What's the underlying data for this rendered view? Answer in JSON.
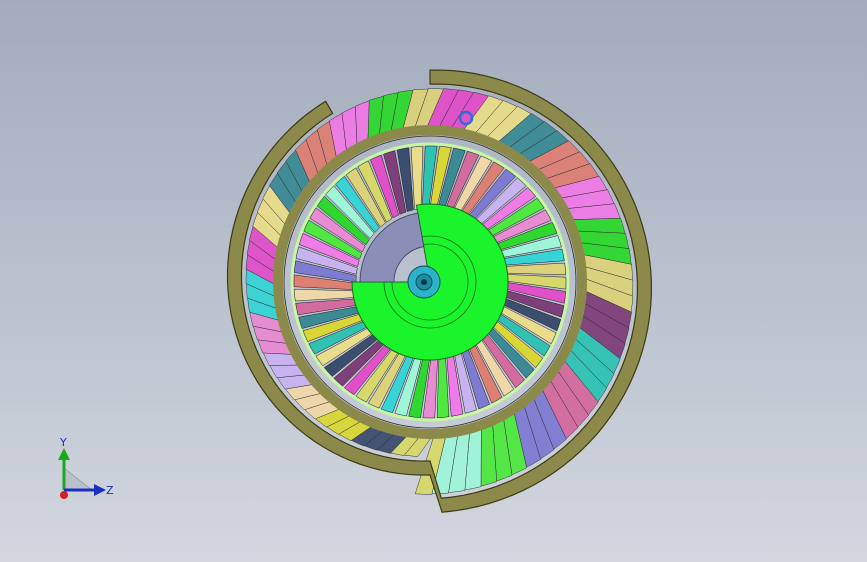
{
  "window": {
    "title": ""
  },
  "viewport": {
    "background_top": "#a3acbd",
    "background_bottom": "#d3d7de",
    "model": "turbine-fan-section-view"
  },
  "triad": {
    "y_label": "Y",
    "z_label": "Z",
    "x_color": "#d42020",
    "y_color": "#1ca81c",
    "z_color": "#1a2fbf"
  },
  "colors": {
    "casing": "#8c8a4a",
    "hub": "#19f52a",
    "shaft": "#2bb3c9",
    "blade_palette": [
      "#e14fc9",
      "#e9dc8a",
      "#3b8a95",
      "#de7f74",
      "#f07ae6",
      "#2ed82e",
      "#dcd27a",
      "#7f3f7a",
      "#2fc2b3",
      "#d36b9e",
      "#7f7bd2",
      "#4ee840",
      "#9ef5d8",
      "#d7d86a",
      "#3c4e6e",
      "#d9d735",
      "#f0d7a8",
      "#c8b3f0",
      "#e98bd2",
      "#37d4d6"
    ]
  }
}
